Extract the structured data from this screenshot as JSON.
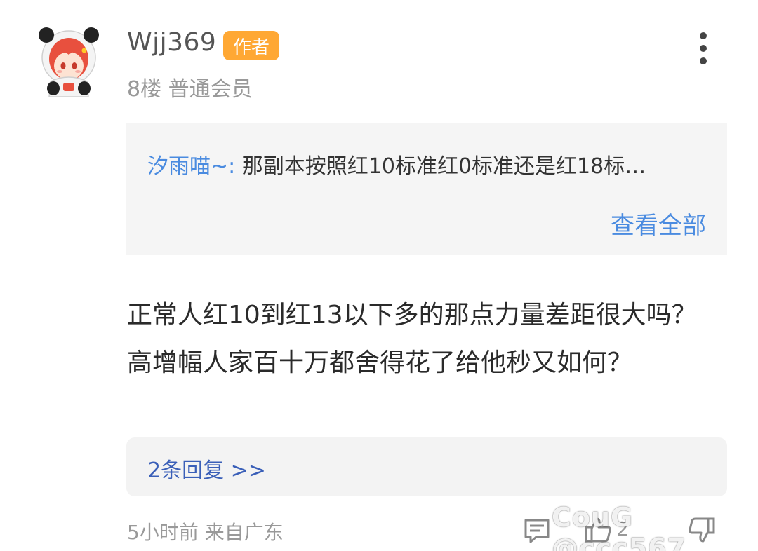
{
  "post": {
    "username": "Wjj369",
    "author_badge": "作者",
    "floor_info": "8楼 普通会员",
    "quote": {
      "author": "汐雨喵~:",
      "text": "那副本按照红10标准红0标准还是红18标…",
      "view_all": "查看全部"
    },
    "body": "正常人红10到红13以下多的那点力量差距很大吗？高增幅人家百十万都舍得花了给他秒又如何？",
    "replies_link": "2条回复 >>",
    "time_location": "5小时前 来自广东",
    "like_count": "2",
    "watermark": "CouG @ccc567"
  },
  "colors": {
    "badge": "#ffa834",
    "link": "#4a8be0",
    "replies_link": "#3a5fb8"
  },
  "icons": [
    "more-vertical-icon",
    "comment-icon",
    "thumbs-up-icon",
    "thumbs-down-icon"
  ]
}
